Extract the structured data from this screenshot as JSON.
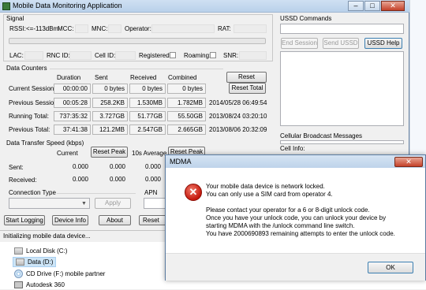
{
  "window": {
    "title": "Mobile Data Monitoring Application",
    "caption": {
      "minimize": "–",
      "maximize": "□",
      "close": "✕"
    }
  },
  "signal": {
    "group_title": "Signal",
    "rssi_label": "RSSI:",
    "rssi_value": "<=-113dBm",
    "mcc_label": "MCC:",
    "mnc_label": "MNC:",
    "operator_label": "Operator:",
    "rat_label": "RAT:",
    "lac_label": "LAC:",
    "rnc_label": "RNC ID:",
    "cell_label": "Cell ID:",
    "registered_label": "Registered:",
    "roaming_label": "Roaming:",
    "snr_label": "SNR:",
    "registered_checked": false,
    "roaming_checked": false
  },
  "data_counters": {
    "group_title": "Data Counters",
    "columns": [
      "Duration",
      "Sent",
      "Received",
      "Combined"
    ],
    "reset_session": "Reset Session",
    "reset_total": "Reset Total",
    "rows": [
      {
        "label": "Current Session:",
        "duration": "00:00:00",
        "sent": "0 bytes",
        "received": "0 bytes",
        "combined": "0 bytes",
        "timestamp": ""
      },
      {
        "label": "Previous Session:",
        "duration": "00:05:28",
        "sent": "258.2KB",
        "received": "1.530MB",
        "combined": "1.782MB",
        "timestamp": "2014/05/28 06:49:54"
      },
      {
        "label": "Running Total:",
        "duration": "737:35:32",
        "sent": "3.727GB",
        "received": "51.77GB",
        "combined": "55.50GB",
        "timestamp": "2013/08/24 03:20:10"
      },
      {
        "label": "Previous Total:",
        "duration": "37:41:38",
        "sent": "121.2MB",
        "received": "2.547GB",
        "combined": "2.665GB",
        "timestamp": "2013/08/06 20:32:09"
      }
    ]
  },
  "speed": {
    "group_title": "Data Transfer Speed (kbps)",
    "current_label": "Current",
    "reset_peak_1": "Reset Peak",
    "average_label": "10s Average",
    "reset_peak_2": "Reset Peak",
    "sent_label": "Sent:",
    "received_label": "Received:",
    "sent_values": [
      "0.000",
      "0.000",
      "0.000"
    ],
    "received_values": [
      "0.000",
      "0.000",
      "0.000"
    ]
  },
  "connection": {
    "type_label": "Connection Type",
    "apply_label": "Apply",
    "apn_label": "APN"
  },
  "buttons": {
    "start_logging": "Start Logging",
    "device_info": "Device Info",
    "about": "About",
    "reset_device": "Reset De"
  },
  "status_text": "Initializing mobile data device...",
  "ussd": {
    "group_title": "USSD Commands",
    "end_session": "End Session",
    "send_ussd": "Send USSD",
    "ussd_help": "USSD Help"
  },
  "cell_broadcast": {
    "title": "Cellular Broadcast Messages",
    "cell_info": "Cell Info:"
  },
  "explorer": {
    "items": [
      "Local Disk (C:)",
      "Data (D:)",
      "CD Drive (F:) mobile partner",
      "Autodesk 360"
    ]
  },
  "dialog": {
    "title": "MDMA",
    "close": "✕",
    "icon": "error-icon",
    "lines": [
      "Your mobile data device is network locked.",
      "You can only use a SIM card from operator 4.",
      "",
      "Please contact your operator for a 6 or 8-digit unlock code.",
      "Once you have your unlock code, you can unlock your device by",
      "starting MDMA with the /unlock command line switch.",
      "You have 2000690893 remaining attempts to enter the unlock code."
    ],
    "ok": "OK"
  }
}
